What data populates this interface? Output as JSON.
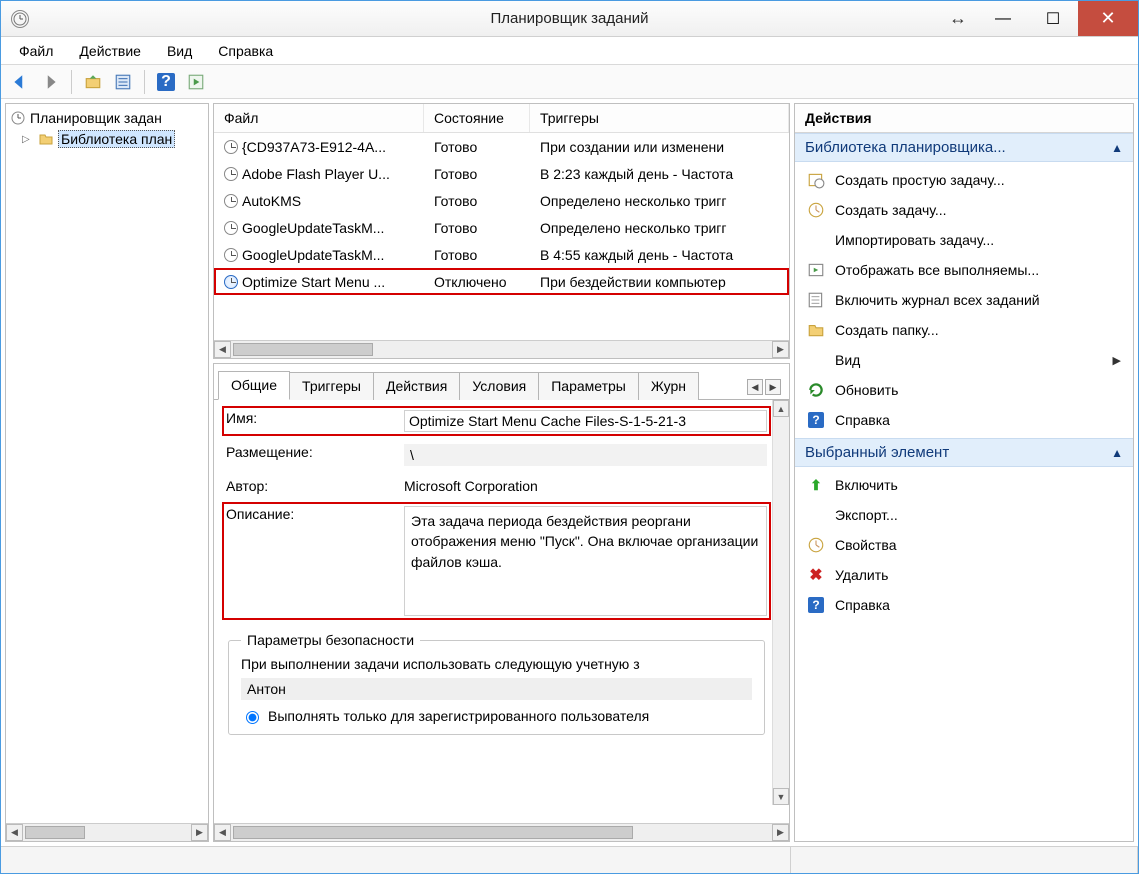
{
  "window": {
    "title": "Планировщик заданий"
  },
  "menu": {
    "file": "Файл",
    "action": "Действие",
    "view": "Вид",
    "help": "Справка"
  },
  "tree": {
    "root": "Планировщик задан",
    "child": "Библиотека план"
  },
  "task_list": {
    "headers": {
      "file": "Файл",
      "state": "Состояние",
      "trigger": "Триггеры"
    },
    "rows": [
      {
        "name": "{CD937A73-E912-4A...",
        "state": "Готово",
        "trigger": "При создании или изменени",
        "highlight": false,
        "blue": false
      },
      {
        "name": "Adobe Flash Player U...",
        "state": "Готово",
        "trigger": "В 2:23 каждый день - Частота",
        "highlight": false,
        "blue": false
      },
      {
        "name": "AutoKMS",
        "state": "Готово",
        "trigger": "Определено несколько тригг",
        "highlight": false,
        "blue": false
      },
      {
        "name": "GoogleUpdateTaskM...",
        "state": "Готово",
        "trigger": "Определено несколько тригг",
        "highlight": false,
        "blue": false
      },
      {
        "name": "GoogleUpdateTaskM...",
        "state": "Готово",
        "trigger": "В 4:55 каждый день - Частота",
        "highlight": false,
        "blue": false
      },
      {
        "name": "Optimize Start Menu ...",
        "state": "Отключено",
        "trigger": "При бездействии компьютер",
        "highlight": true,
        "blue": true
      }
    ]
  },
  "tabs": {
    "general": "Общие",
    "triggers": "Триггеры",
    "actions": "Действия",
    "conditions": "Условия",
    "settings": "Параметры",
    "log": "Журн"
  },
  "details": {
    "name_label": "Имя:",
    "name_value": "Optimize Start Menu Cache Files-S-1-5-21-3",
    "location_label": "Размещение:",
    "location_value": "\\",
    "author_label": "Автор:",
    "author_value": "Microsoft Corporation",
    "description_label": "Описание:",
    "description_value": "Эта задача периода бездействия реоргани отображения меню \"Пуск\". Она включае организации файлов кэша.",
    "security_legend": "Параметры безопасности",
    "security_text": "При выполнении задачи использовать следующую учетную з",
    "account": "Антон",
    "radio_text": "Выполнять только для зарегистрированного пользователя"
  },
  "actions_pane": {
    "header": "Действия",
    "group1": "Библиотека планировщика...",
    "group1_items": {
      "create_basic": "Создать простую задачу...",
      "create": "Создать задачу...",
      "import": "Импортировать задачу...",
      "show_running": "Отображать все выполняемы...",
      "enable_history": "Включить журнал всех заданий",
      "new_folder": "Создать папку...",
      "view": "Вид",
      "refresh": "Обновить",
      "help": "Справка"
    },
    "group2": "Выбранный элемент",
    "group2_items": {
      "enable": "Включить",
      "export": "Экспорт...",
      "properties": "Свойства",
      "delete": "Удалить",
      "help": "Справка"
    }
  }
}
